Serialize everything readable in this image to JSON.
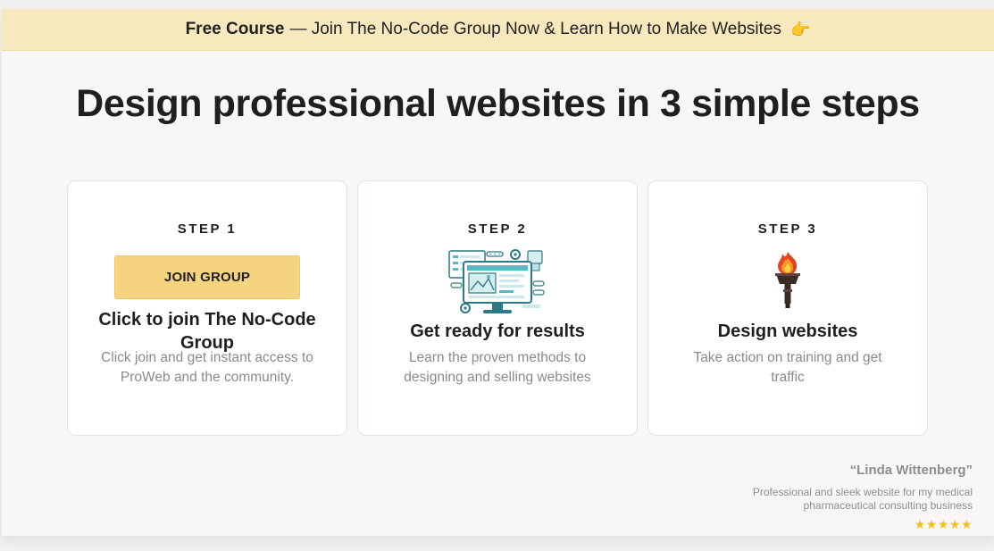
{
  "banner": {
    "bold": "Free Course",
    "text": "— Join The No-Code Group Now & Learn How to Make Websites",
    "icon": "pointing-hand-icon"
  },
  "headline": "Design professional websites in 3 simple steps",
  "steps": [
    {
      "label": "STEP 1",
      "button": "JOIN GROUP",
      "title": "Click to join The No-Code Group",
      "description": "Click join and get instant access to ProWeb and the community."
    },
    {
      "label": "STEP 2",
      "icon": "web-design-illustration-icon",
      "title": "Get ready for results",
      "description": "Learn the proven methods to designing and selling websites"
    },
    {
      "label": "STEP 3",
      "icon": "torch-icon",
      "title": "Design websites",
      "description": "Take action on training and get traffic"
    }
  ],
  "testimonial": {
    "name": "“Linda Wittenberg”",
    "text": "Professional and sleek website for my medical pharmaceutical consulting business",
    "stars": "★★★★★",
    "rating": 5
  },
  "colors": {
    "banner_bg": "#f7e8bd",
    "button_bg": "#f6d37e",
    "star": "#f2c022"
  }
}
